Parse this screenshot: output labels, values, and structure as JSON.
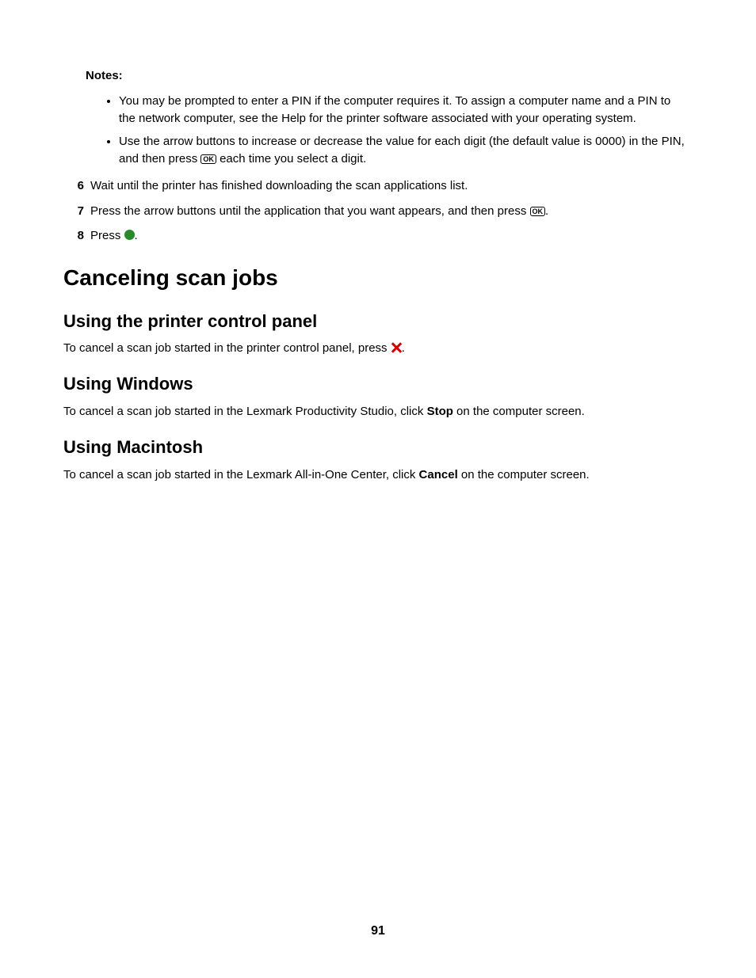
{
  "notes_label": "Notes:",
  "notes": [
    "You may be prompted to enter a PIN if the computer requires it. To assign a computer name and a PIN to the network computer, see the Help for the printer software associated with your operating system.",
    {
      "pre": "Use the arrow buttons to increase or decrease the value for each digit (the default value is 0000) in the PIN, and then press ",
      "icon": "ok-icon",
      "post": " each time you select a digit."
    }
  ],
  "steps": {
    "s6": {
      "num": "6",
      "text": "Wait until the printer has finished downloading the scan applications list."
    },
    "s7": {
      "num": "7",
      "pre": "Press the arrow buttons until the application that you want appears, and then press ",
      "post": "."
    },
    "s8": {
      "num": "8",
      "pre": "Press ",
      "post": "."
    }
  },
  "h_cancel": "Canceling scan jobs",
  "h_panel": "Using the printer control panel",
  "p_panel_pre": "To cancel a scan job started in the printer control panel, press ",
  "p_panel_post": ".",
  "h_win": "Using Windows",
  "p_win_pre": "To cancel a scan job started in the Lexmark Productivity Studio, click ",
  "p_win_bold": "Stop",
  "p_win_post": " on the computer screen.",
  "h_mac": "Using Macintosh",
  "p_mac_pre": "To cancel a scan job started in the Lexmark All-in-One Center, click ",
  "p_mac_bold": "Cancel",
  "p_mac_post": " on the computer screen.",
  "page_number": "91",
  "ok_label": "OK"
}
